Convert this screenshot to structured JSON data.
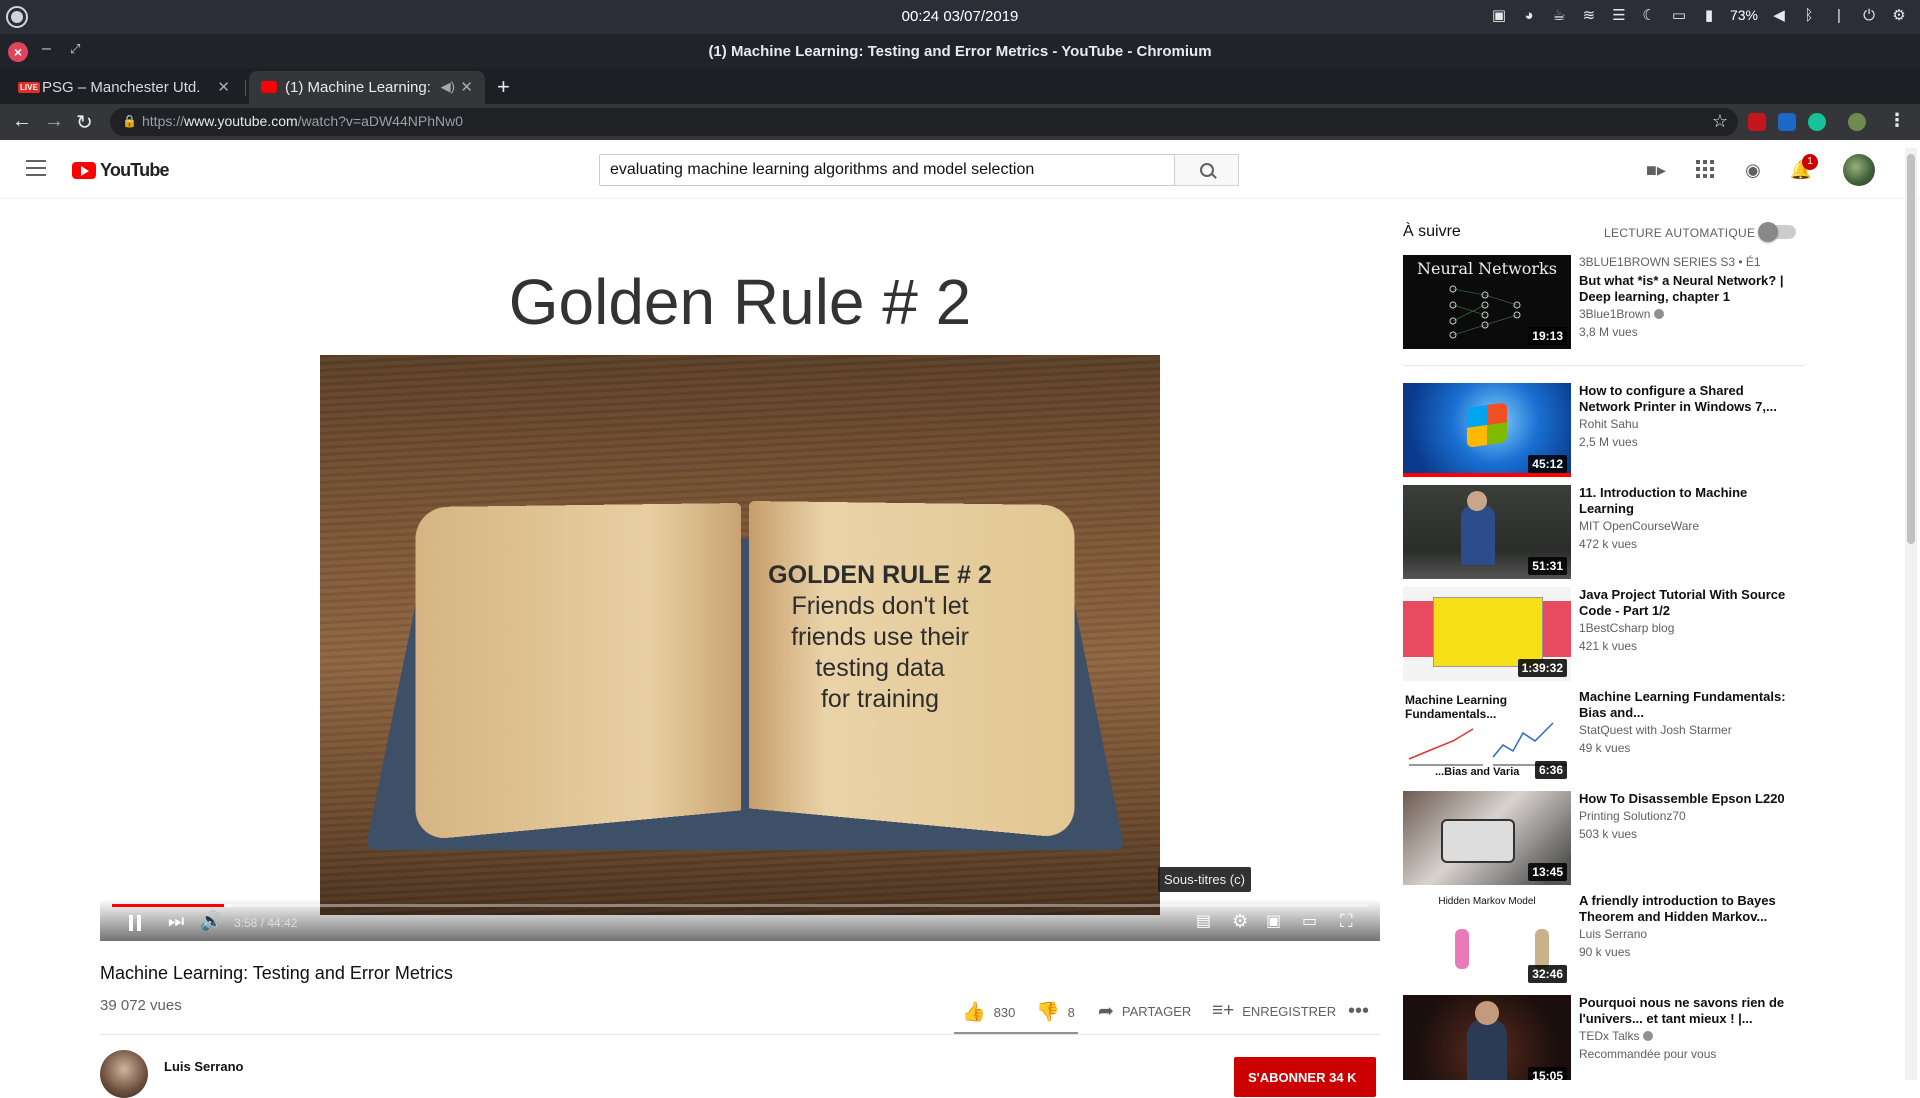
{
  "os": {
    "clock": "00:24 03/07/2019",
    "battery": "73%"
  },
  "window": {
    "title": "(1) Machine Learning: Testing and Error Metrics - YouTube - Chromium"
  },
  "tabs": [
    {
      "label": "PSG – Manchester Utd. liv",
      "badge": "LIVE"
    },
    {
      "label": "(1) Machine Learning: "
    }
  ],
  "toolbar": {
    "url_scheme": "https://",
    "url_host": "www.youtube.com",
    "url_path": "/watch?v=aDW44NPhNw0"
  },
  "youtube": {
    "logo_text": "YouTube",
    "search_query": "evaluating machine learning algorithms and model selection",
    "notification_count": "1"
  },
  "player": {
    "slide_title": "Golden Rule # 2",
    "page_heading": "GOLDEN RULE # 2",
    "page_lines": [
      "Friends don't let",
      "friends use their",
      "testing data",
      "for training"
    ],
    "time": "3:58 / 44:42",
    "tooltip": "Sous-titres (c)",
    "progress_fraction": 0.089
  },
  "video": {
    "title": "Machine Learning: Testing and Error Metrics",
    "views": "39 072 vues",
    "likes": "830",
    "dislikes": "8",
    "share_label": "PARTAGER",
    "save_label": "ENREGISTRER",
    "channel": "Luis Serrano",
    "subscribe_label": "S'ABONNER  34 K"
  },
  "sidebar": {
    "up_next": "À suivre",
    "autoplay": "LECTURE AUTOMATIQUE",
    "items": [
      {
        "supertitle": "3BLUE1BROWN SERIES   S3 • É1",
        "title": "But what *is* a Neural Network? | Deep learning, chapter 1",
        "channel": "3Blue1Brown",
        "views": "3,8 M vues",
        "duration": "19:13",
        "thumb_text": "Neural Networks"
      },
      {
        "title": "How to configure a Shared Network Printer in Windows 7,...",
        "channel": "Rohit Sahu",
        "views": "2,5 M vues",
        "duration": "45:12"
      },
      {
        "title": "11. Introduction to Machine Learning",
        "channel": "MIT OpenCourseWare",
        "views": "472 k vues",
        "duration": "51:31"
      },
      {
        "title": "Java Project Tutorial With Source Code - Part 1/2",
        "channel": "1BestCsharp blog",
        "views": "421 k vues",
        "duration": "1:39:32"
      },
      {
        "title": "Machine Learning Fundamentals: Bias and...",
        "channel": "StatQuest with Josh Starmer",
        "views": "49 k vues",
        "duration": "6:36",
        "thumb_text": "Machine Learning Fundamentals...",
        "thumb_text2": "...Bias and Varia"
      },
      {
        "title": "How To Disassemble Epson L220",
        "channel": "Printing Solutionz70",
        "views": "503 k vues",
        "duration": "13:45"
      },
      {
        "title": "A friendly introduction to Bayes Theorem and Hidden Markov...",
        "channel": "Luis Serrano",
        "views": "90 k vues",
        "duration": "32:46",
        "thumb_text": "Hidden Markov Model"
      },
      {
        "title": "Pourquoi nous ne savons rien de l'univers... et tant mieux ! |...",
        "channel": "TEDx Talks",
        "views": "Recommandée pour vous",
        "duration": "15:05"
      }
    ]
  },
  "colors": {
    "youtube_red": "#ff0000",
    "subscribe_red": "#cc0000",
    "chrome_dark": "#35363a"
  }
}
